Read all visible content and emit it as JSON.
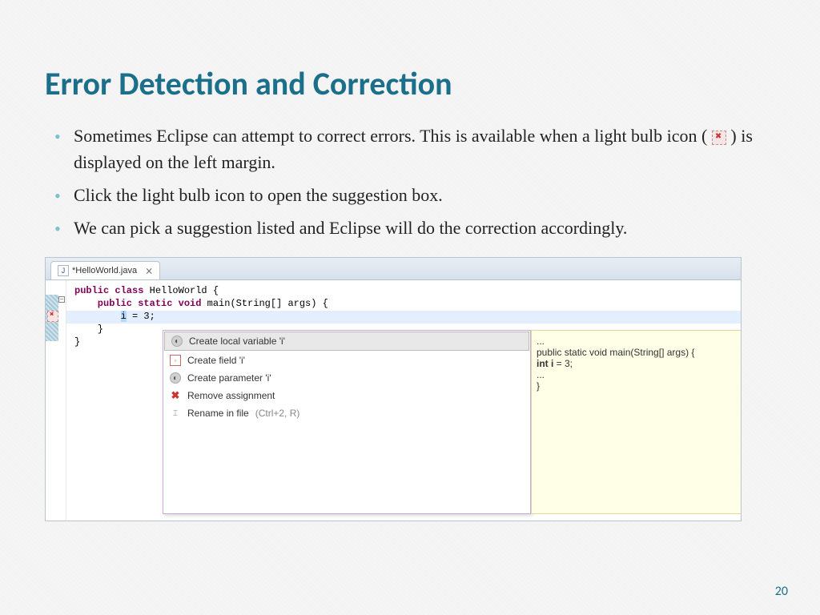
{
  "title": "Error Detection and Correction",
  "bullets": [
    {
      "pre": "Sometimes Eclipse can attempt to correct errors.  This is available when a light bulb icon ( ",
      "post": " ) is displayed on the left margin.",
      "icon": true
    },
    {
      "text": "Click the light bulb icon to open the suggestion box."
    },
    {
      "text": "We can pick a suggestion listed and Eclipse will do the correction accordingly."
    }
  ],
  "eclipse": {
    "tab": {
      "filename": "*HelloWorld.java"
    },
    "code": {
      "line1_pre": "public class ",
      "line1_name": "HelloWorld {",
      "line2_pre": "    public static void ",
      "line2_rest": "main(String[] args) {",
      "line3_pre": "        ",
      "line3_var": "i",
      "line3_rest": " = 3;",
      "line4": "    }",
      "line5": "}"
    },
    "quickfix": [
      {
        "label": "Create local variable 'i'",
        "icon": "circ",
        "selected": true
      },
      {
        "label": "Create field 'i'",
        "icon": "sq"
      },
      {
        "label": "Create parameter 'i'",
        "icon": "circ"
      },
      {
        "label": "Remove assignment",
        "icon": "x"
      },
      {
        "label": "Rename in file",
        "shortcut": "(Ctrl+2, R)",
        "icon": "ren"
      }
    ],
    "preview": {
      "l1": "...",
      "l2": "public static void main(String[] args) {",
      "l3a": "int i",
      "l3b": " = 3;",
      "l4": "...",
      "l5": "}"
    }
  },
  "page_number": "20"
}
